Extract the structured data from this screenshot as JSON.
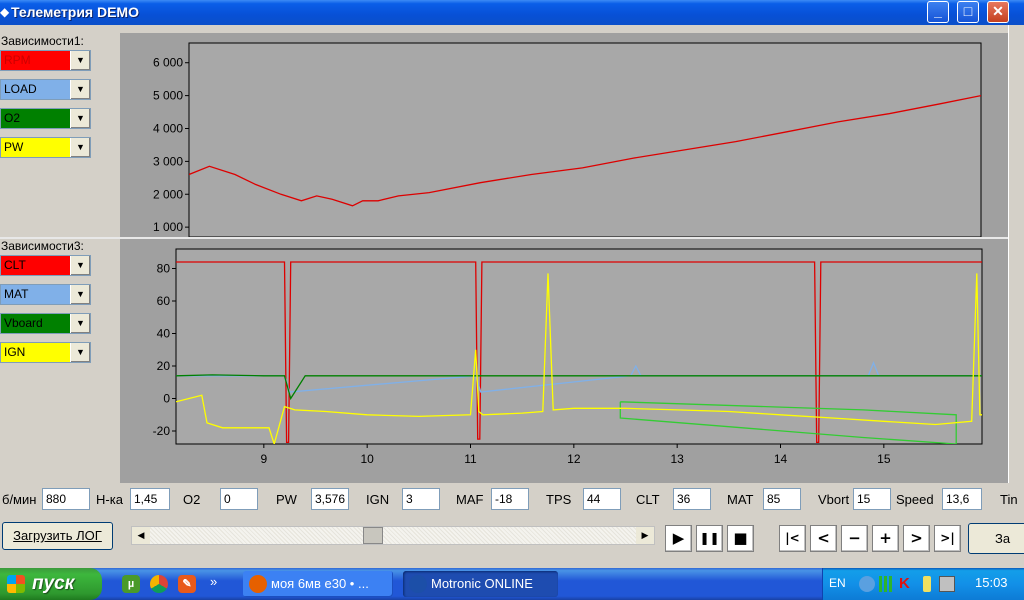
{
  "window": {
    "title": "Телеметрия DEMO"
  },
  "left": {
    "group1_label": "Зависимости1:",
    "group1": [
      {
        "label": "RPM",
        "color": "#ff0000",
        "text_color": "#cc0000"
      },
      {
        "label": "LOAD",
        "color": "#80b0e8",
        "text_color": "#000000"
      },
      {
        "label": "O2",
        "color": "#008000",
        "text_color": "#000000"
      },
      {
        "label": "PW",
        "color": "#ffff00",
        "text_color": "#000000"
      }
    ],
    "group3_label": "Зависимости3:",
    "group3": [
      {
        "label": "CLT",
        "color": "#ff0000",
        "text_color": "#000000"
      },
      {
        "label": "MAT",
        "color": "#80b0e8",
        "text_color": "#000000"
      },
      {
        "label": "Vboard",
        "color": "#008000",
        "text_color": "#000000"
      },
      {
        "label": "IGN",
        "color": "#ffff00",
        "text_color": "#000000"
      }
    ]
  },
  "chart_data": [
    {
      "type": "line",
      "y_ticks": [
        "6 000",
        "5 000",
        "4 000",
        "3 000",
        "2 000",
        "1 000"
      ],
      "y_tick_values": [
        6000,
        5000,
        4000,
        3000,
        2000,
        1000
      ],
      "ylim": [
        700,
        6600
      ],
      "xlim": [
        8.15,
        15.9
      ],
      "grid": false,
      "series": [
        {
          "name": "RPM",
          "color": "#dd0000",
          "x": [
            8.15,
            8.35,
            8.6,
            8.8,
            9.05,
            9.25,
            9.4,
            9.55,
            9.75,
            9.85,
            10.0,
            10.2,
            10.5,
            11.0,
            11.5,
            12.0,
            12.5,
            13.0,
            13.5,
            14.0,
            14.5,
            15.0,
            15.5,
            15.9
          ],
          "values": [
            2600,
            2850,
            2600,
            2300,
            2000,
            1800,
            1950,
            1850,
            1650,
            1800,
            1800,
            1950,
            2050,
            2350,
            2600,
            2800,
            3100,
            3350,
            3600,
            3900,
            4200,
            4450,
            4750,
            5000
          ]
        }
      ]
    },
    {
      "type": "line",
      "x_ticks": [
        "9",
        "10",
        "11",
        "12",
        "13",
        "14",
        "15"
      ],
      "x_tick_values": [
        9,
        10,
        11,
        12,
        13,
        14,
        15
      ],
      "y_ticks": [
        "80",
        "60",
        "40",
        "20",
        "0",
        "-20"
      ],
      "y_tick_values": [
        80,
        60,
        40,
        20,
        0,
        -20
      ],
      "ylim": [
        -28,
        92
      ],
      "xlim": [
        8.15,
        15.95
      ],
      "grid": false,
      "series": [
        {
          "name": "CLT",
          "color": "#dd0000",
          "x": [
            8.15,
            9.2,
            9.22,
            9.24,
            9.26,
            11.05,
            11.07,
            11.09,
            11.11,
            14.33,
            14.35,
            14.37,
            14.39,
            15.95
          ],
          "values": [
            84,
            84,
            -27,
            -27,
            84,
            84,
            -25,
            -25,
            84,
            84,
            -27,
            -27,
            84,
            84
          ]
        },
        {
          "name": "MAT",
          "color": "#80b0e8",
          "x": [
            8.15,
            9.2,
            9.25,
            11.05,
            11.1,
            12.55,
            12.6,
            12.65,
            14.85,
            14.9,
            14.95,
            15.95
          ],
          "values": [
            14,
            14,
            4,
            14,
            4,
            14,
            20,
            14,
            14,
            22,
            14,
            14
          ]
        },
        {
          "name": "Vboard",
          "color": "#008000",
          "x": [
            8.15,
            8.5,
            9.0,
            9.2,
            9.26,
            9.4,
            10.0,
            11.0,
            12.0,
            13.0,
            14.0,
            15.0,
            15.95
          ],
          "values": [
            14,
            14.5,
            14,
            14,
            0,
            14,
            14,
            14,
            14,
            14,
            14,
            14,
            14
          ]
        },
        {
          "name": "Vboard-box",
          "color": "#33cc33",
          "x": [
            12.45,
            14.8,
            15.7,
            15.7,
            14.8,
            12.45,
            12.45
          ],
          "values": [
            -2,
            -7,
            -10,
            -28,
            -24,
            -12,
            -2
          ]
        },
        {
          "name": "IGN",
          "color": "#ffff00",
          "x": [
            8.15,
            8.4,
            8.45,
            8.6,
            9.05,
            9.1,
            9.2,
            9.3,
            9.6,
            10.0,
            10.5,
            11.0,
            11.05,
            11.08,
            11.12,
            11.5,
            11.7,
            11.75,
            11.8,
            12.0,
            12.5,
            13.0,
            13.5,
            14.0,
            14.5,
            15.0,
            15.5,
            15.85,
            15.9,
            15.93,
            15.95
          ],
          "values": [
            -2,
            2,
            -15,
            -18,
            -18,
            -28,
            -5,
            -7,
            -8,
            -10,
            -11,
            -10,
            30,
            -8,
            -10,
            -9,
            -8,
            77,
            -7,
            -6,
            -6,
            -7,
            -8,
            -10,
            -12,
            -14,
            -16,
            -14,
            77,
            -10,
            -10
          ]
        }
      ]
    }
  ],
  "readouts": [
    {
      "label": "б/мин",
      "value": "880"
    },
    {
      "label": "Н-ка",
      "value": "1,45"
    },
    {
      "label": "O2",
      "value": "0"
    },
    {
      "label": "PW",
      "value": "3,576"
    },
    {
      "label": "IGN",
      "value": "3"
    },
    {
      "label": "MAF",
      "value": "-18"
    },
    {
      "label": "TPS",
      "value": "44"
    },
    {
      "label": "CLT",
      "value": "36"
    },
    {
      "label": "MAT",
      "value": "85"
    },
    {
      "label": "Vbort",
      "value": "15"
    },
    {
      "label": "Speed",
      "value": "13,6"
    },
    {
      "label": "Tin",
      "value": ""
    }
  ],
  "controls": {
    "load_log": "Загрузить ЛОГ",
    "za_label": "За",
    "scroll_position": 0.455,
    "playback": [
      {
        "name": "play-button",
        "glyph": "▶"
      },
      {
        "name": "pause-button",
        "glyph": "❚❚"
      },
      {
        "name": "stop-button",
        "glyph": "■"
      },
      {
        "name": "first-button",
        "glyph": "|<"
      },
      {
        "name": "prev-button",
        "glyph": "<"
      },
      {
        "name": "minus-button",
        "glyph": "−"
      },
      {
        "name": "plus-button",
        "glyph": "+"
      },
      {
        "name": "next-button",
        "glyph": ">"
      },
      {
        "name": "last-button",
        "glyph": ">|"
      }
    ]
  },
  "taskbar": {
    "start_label": "пуск",
    "tasks": [
      {
        "label": "моя 6мв e30 • ...",
        "icon_color": "#e66000",
        "active": false
      },
      {
        "label": "Motronic ONLINE",
        "icon_color": "#1c4fa8",
        "active": true
      }
    ],
    "overflow": "»",
    "language": "EN",
    "clock": "15:03"
  }
}
